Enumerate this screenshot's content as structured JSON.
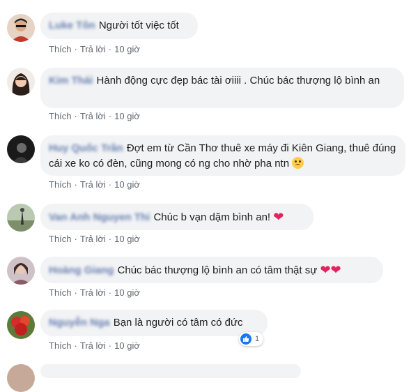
{
  "comments": [
    {
      "author": "Luke Tôn",
      "text": "Người tốt việc tốt",
      "actions": {
        "like": "Thích",
        "reply": "Trả lời",
        "time": "10 giờ"
      }
    },
    {
      "author": "Kim Thái",
      "text": "Hành động cực đẹp bác tài ơiiii . Chúc bác thượng lộ bình an",
      "actions": {
        "like": "Thích",
        "reply": "Trả lời",
        "time": "10 giờ"
      }
    },
    {
      "author": "Huy Quốc Trần",
      "text": "Đợt em từ Cần Thơ thuê xe máy đi Kiên Giang, thuê đúng cái xe ko có đèn, cũng mong có ng cho nhờ pha ntn",
      "actions": {
        "like": "Thích",
        "reply": "Trả lời",
        "time": "10 giờ"
      }
    },
    {
      "author": "Van Anh Nguyen Thi",
      "text": "Chúc b vạn dặm bình an!",
      "actions": {
        "like": "Thích",
        "reply": "Trả lời",
        "time": "10 giờ"
      }
    },
    {
      "author": "Hoàng Giang",
      "text": "Chúc bác thượng lộ bình an có tâm thật sự",
      "actions": {
        "like": "Thích",
        "reply": "Trả lời",
        "time": "10 giờ"
      }
    },
    {
      "author": "Nguyễn Nga",
      "text": "Bạn là người có tâm có đức",
      "actions": {
        "like": "Thích",
        "reply": "Trả lời",
        "time": "10 giờ"
      },
      "like_count": "1"
    }
  ],
  "separator": "·",
  "colors": {
    "bubble": "#f2f3f5",
    "author": "#385898",
    "actions": "#606770",
    "like_blue": "#1877f2",
    "heart": "#e0245e"
  },
  "icons": [
    "heart-emoji-icon",
    "sad-emoji-icon",
    "like-thumb-icon"
  ]
}
